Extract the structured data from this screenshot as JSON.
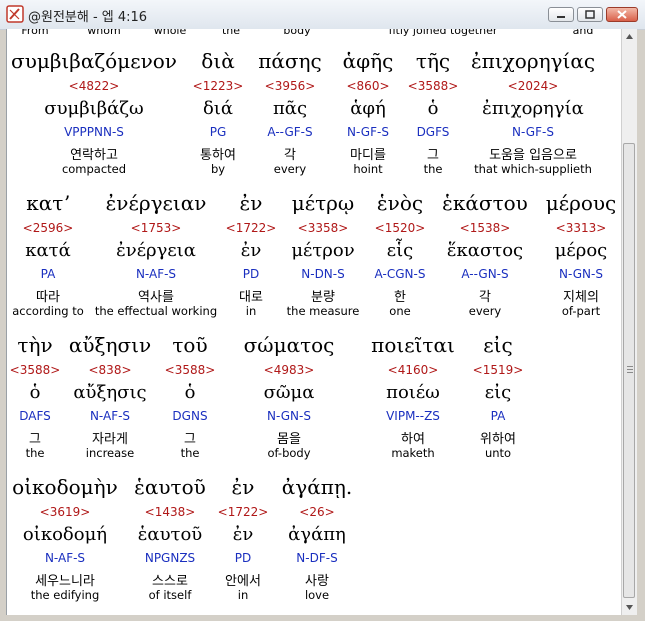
{
  "window": {
    "title": "@원전분해 - 엡 4:16",
    "minimize_icon": "minimize-icon",
    "maximize_icon": "maximize-icon",
    "close_icon": "close-icon"
  },
  "top_row": [
    "From",
    "whom",
    "whole",
    "the",
    "body",
    "fitly joined together",
    "and"
  ],
  "rows": [
    [
      {
        "greek": "συμβιβαζόμενον",
        "strong": "<4822>",
        "lemma": "συμβιβάζω",
        "morph": "VPPPNN-S",
        "korean": "연락하고",
        "english": "compacted"
      },
      {
        "greek": "διὰ",
        "strong": "<1223>",
        "lemma": "διά",
        "morph": "PG",
        "korean": "통하여",
        "english": "by"
      },
      {
        "greek": "πάσης",
        "strong": "<3956>",
        "lemma": "πᾶς",
        "morph": "A--GF-S",
        "korean": "각",
        "english": "every"
      },
      {
        "greek": "ἁφῆς",
        "strong": "<860>",
        "lemma": "ἁφή",
        "morph": "N-GF-S",
        "korean": "마디를",
        "english": "hoint"
      },
      {
        "greek": "τῆς",
        "strong": "<3588>",
        "lemma": "ὁ",
        "morph": "DGFS",
        "korean": "그",
        "english": "the"
      },
      {
        "greek": "ἐπιχορηγίας",
        "strong": "<2024>",
        "lemma": "ἐπιχορηγία",
        "morph": "N-GF-S",
        "korean": "도움을 입음으로",
        "english": "that which-supplieth"
      }
    ],
    [
      {
        "greek": "κατʼ",
        "strong": "<2596>",
        "lemma": "κατά",
        "morph": "PA",
        "korean": "따라",
        "english": "according to"
      },
      {
        "greek": "ἐνέργειαν",
        "strong": "<1753>",
        "lemma": "ἐνέργεια",
        "morph": "N-AF-S",
        "korean": "역사를",
        "english": "the effectual working"
      },
      {
        "greek": "ἐν",
        "strong": "<1722>",
        "lemma": "ἐν",
        "morph": "PD",
        "korean": "대로",
        "english": "in"
      },
      {
        "greek": "μέτρῳ",
        "strong": "<3358>",
        "lemma": "μέτρον",
        "morph": "N-DN-S",
        "korean": "분량",
        "english": "the measure"
      },
      {
        "greek": "ἑνὸς",
        "strong": "<1520>",
        "lemma": "εἷς",
        "morph": "A-CGN-S",
        "korean": "한",
        "english": "one"
      },
      {
        "greek": "ἑκάστου",
        "strong": "<1538>",
        "lemma": "ἕκαστος",
        "morph": "A--GN-S",
        "korean": "각",
        "english": "every"
      },
      {
        "greek": "μέρους",
        "strong": "<3313>",
        "lemma": "μέρος",
        "morph": "N-GN-S",
        "korean": "지체의",
        "english": "of-part"
      }
    ],
    [
      {
        "greek": "τὴν",
        "strong": "<3588>",
        "lemma": "ὁ",
        "morph": "DAFS",
        "korean": "그",
        "english": "the"
      },
      {
        "greek": "αὔξησιν",
        "strong": "<838>",
        "lemma": "αὔξησις",
        "morph": "N-AF-S",
        "korean": "자라게",
        "english": "increase"
      },
      {
        "greek": "τοῦ",
        "strong": "<3588>",
        "lemma": "ὁ",
        "morph": "DGNS",
        "korean": "그",
        "english": "the"
      },
      {
        "greek": "σώματος",
        "strong": "<4983>",
        "lemma": "σῶμα",
        "morph": "N-GN-S",
        "korean": "몸을",
        "english": "of-body"
      },
      {
        "greek": "ποιεῖται",
        "strong": "<4160>",
        "lemma": "ποιέω",
        "morph": "VIPM--ZS",
        "korean": "하여",
        "english": "maketh"
      },
      {
        "greek": "εἰς",
        "strong": "<1519>",
        "lemma": "εἰς",
        "morph": "PA",
        "korean": "위하여",
        "english": "unto"
      }
    ],
    [
      {
        "greek": "οἰκοδομὴν",
        "strong": "<3619>",
        "lemma": "οἰκοδομή",
        "morph": "N-AF-S",
        "korean": "세우느니라",
        "english": "the edifying"
      },
      {
        "greek": "ἑαυτοῦ",
        "strong": "<1438>",
        "lemma": "ἑαυτοῦ",
        "morph": "NPGNZS",
        "korean": "스스로",
        "english": "of itself"
      },
      {
        "greek": "ἐν",
        "strong": "<1722>",
        "lemma": "ἐν",
        "morph": "PD",
        "korean": "안에서",
        "english": "in"
      },
      {
        "greek": "ἀγάπῃ.",
        "strong": "<26>",
        "lemma": "ἀγάπη",
        "morph": "N-DF-S",
        "korean": "사랑",
        "english": "love"
      }
    ]
  ]
}
